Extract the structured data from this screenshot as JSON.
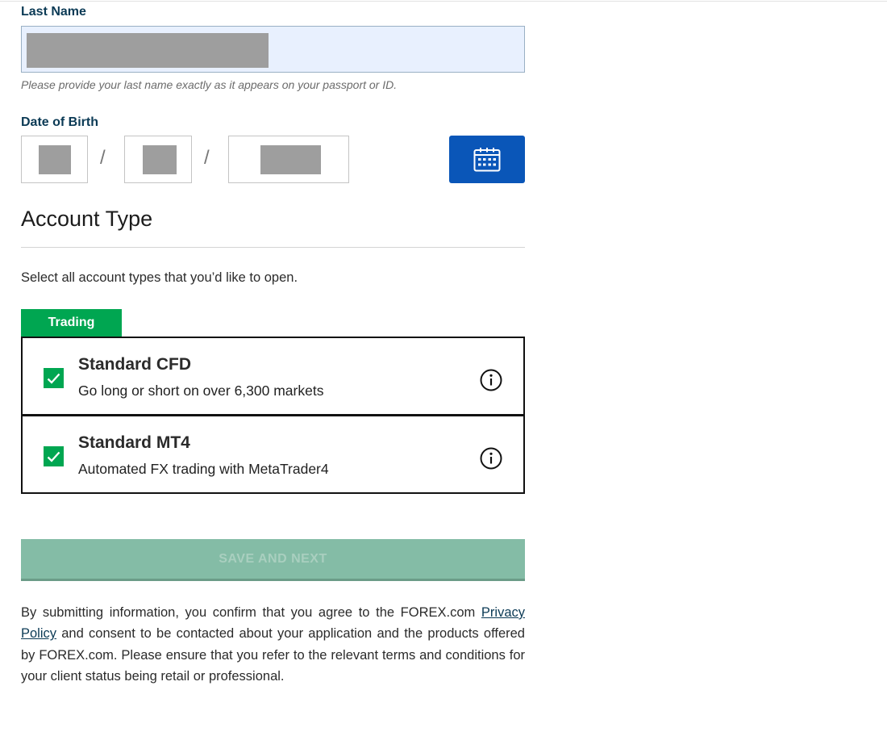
{
  "personal": {
    "last_name_label": "Last Name",
    "last_name_hint": "Please provide your last name exactly as it appears on your passport or ID.",
    "dob_label": "Date of Birth",
    "dob_separator": "/"
  },
  "account_type": {
    "title": "Account Type",
    "instructions": "Select all account types that you’d like to open.",
    "category_tag": "Trading",
    "options": [
      {
        "name": "Standard CFD",
        "description": "Go long or short on over 6,300 markets",
        "checked": true
      },
      {
        "name": "Standard MT4",
        "description": "Automated FX trading with MetaTrader4",
        "checked": true
      }
    ]
  },
  "submit": {
    "label": "SAVE AND NEXT"
  },
  "disclaimer": {
    "before_link": "By submitting information, you confirm that you agree to the FOREX.com ",
    "link_text": "Privacy Policy",
    "after_link": " and consent to be contacted about your application and the products offered by FOREX.com. Please ensure that you refer to the relevant terms and conditions for your client status being retail or professional."
  },
  "colors": {
    "label_navy": "#0b3a55",
    "calendar_blue": "#0a56b8",
    "accent_green": "#00a651",
    "submit_disabled": "#84bca6"
  },
  "icons": {
    "calendar": "calendar-icon",
    "checkmark": "checkmark-icon",
    "info": "info-icon"
  }
}
